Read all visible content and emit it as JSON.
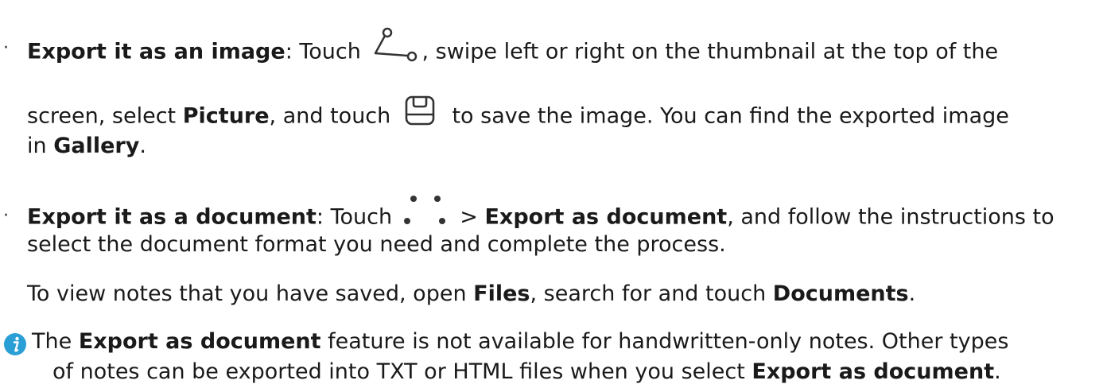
{
  "bullet_char": "·",
  "item1": {
    "bold_title": "Export it as an image",
    "after_title": ": Touch ",
    "share_icon_name": "share-icon",
    "after_share": ", swipe left or right on the thumbnail at the top of the",
    "line2_before": "screen, select ",
    "picture": "Picture",
    "line2_mid": ", and touch ",
    "save_icon_name": "save-icon",
    "line2_after": " to save the image. You can find the exported image",
    "line3_before": "in ",
    "gallery": "Gallery",
    "line3_after": "."
  },
  "item2": {
    "bold_title": "Export it as a document",
    "after_title": ": Touch ",
    "more_icon_name": "more-icon",
    "gt": " > ",
    "export_as_document": "Export as document",
    "after_export": ", and follow the instructions to",
    "line2": "select the document format you need and complete the process.",
    "line3_before": "To view notes that you have saved, open ",
    "files": "Files",
    "line3_mid": ", search for and touch ",
    "documents": "Documents",
    "line3_after": "."
  },
  "note": {
    "info_icon_name": "info-icon",
    "info_color": "#2a9fd6",
    "line1_before": "The ",
    "export_as_document": "Export as document",
    "line1_after": " feature is not available for handwritten-only notes. Other types",
    "line2_before": "of notes can be exported into TXT or HTML files when you select ",
    "export_as_document_2": "Export as document",
    "line2_after": "."
  }
}
